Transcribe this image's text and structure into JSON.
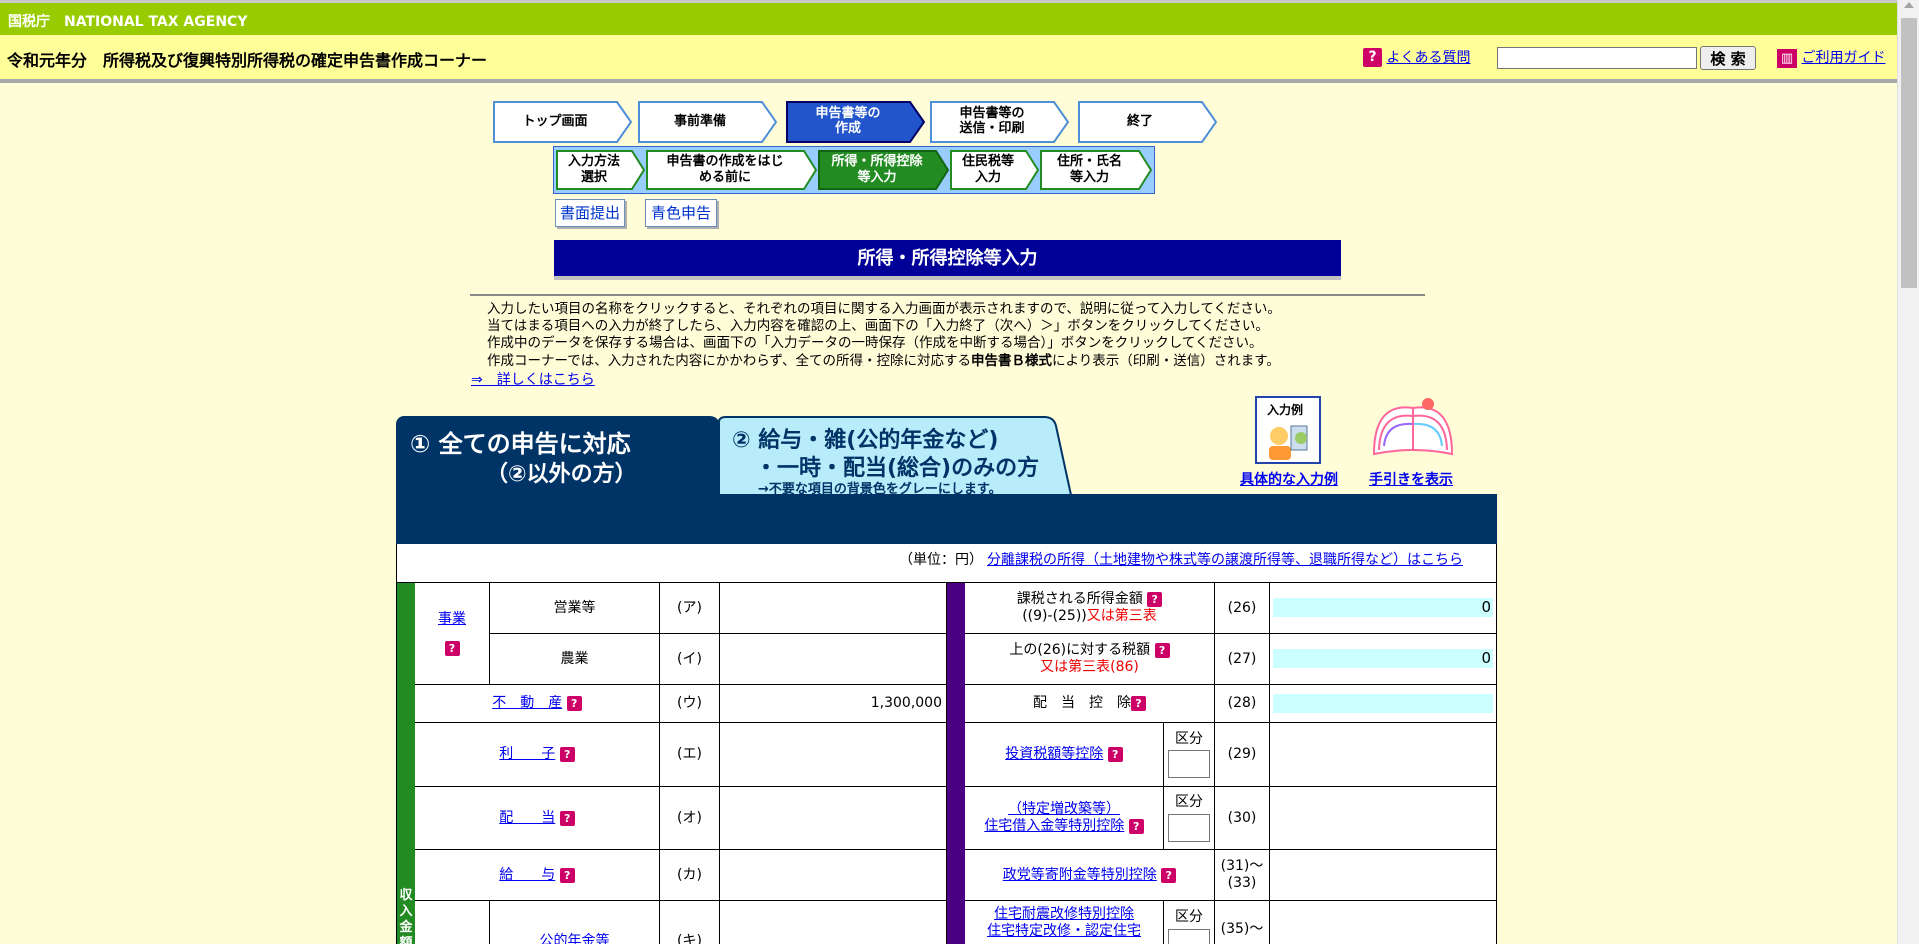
{
  "agency": {
    "name": "国税庁　NATIONAL TAX AGENCY"
  },
  "header": {
    "title": "令和元年分　所得税及び復興特別所得税の確定申告書作成コーナー",
    "faq_label": "よくある質問",
    "search_button": "検 索",
    "search_value": "",
    "guide_label": "ご利用ガイド"
  },
  "steps": [
    {
      "label": "トップ画面",
      "active": false
    },
    {
      "label": "事前準備",
      "active": false
    },
    {
      "label": "申告書等の\n作成",
      "active": true
    },
    {
      "label": "申告書等の\n送信・印刷",
      "active": false
    },
    {
      "label": "終了",
      "active": false
    }
  ],
  "substeps": [
    {
      "label": "入力方法\n選択",
      "active": false
    },
    {
      "label": "申告書の作成をはじ\nめる前に",
      "active": false
    },
    {
      "label": "所得・所得控除\n等入力",
      "active": true
    },
    {
      "label": "住民税等\n入力",
      "active": false
    },
    {
      "label": "住所・氏名\n等入力",
      "active": false
    }
  ],
  "modes": {
    "paper": "書面提出",
    "blue": "青色申告"
  },
  "section_title": "所得・所得控除等入力",
  "instructions": {
    "line1": "入力したい項目の名称をクリックすると、それぞれの項目に関する入力画面が表示されますので、説明に従って入力してください。",
    "line2": "当てはまる項目への入力が終了したら、入力内容を確認の上、画面下の「入力終了（次へ）＞」ボタンをクリックしてください。",
    "line3": "作成中のデータを保存する場合は、画面下の「入力データの一時保存（作成を中断する場合）」ボタンをクリックしてください。",
    "line4_pre": "作成コーナーでは、入力された内容にかかわらず、全ての所得・控除に対応する",
    "line4_bold": "申告書Ｂ様式",
    "line4_post": "により表示（印刷・送信）されます。",
    "detail_link": "⇒　詳しくはこちら"
  },
  "tabs": {
    "tab1_line1": "① 全ての申告に対応",
    "tab1_line2": "（②以外の方）",
    "tab2_line1": "② 給与・雑(公的年金など)",
    "tab2_line2": "・一時・配当(総合)のみの方",
    "tab2_line3": "→不要な項目の背景色をグレーにします。"
  },
  "aids": {
    "example_icon_text": "入力例",
    "example_link": "具体的な入力例",
    "guide_link": "手引きを表示"
  },
  "table": {
    "unit": "（単位：円）",
    "separate_link": "分離課税の所得（土地建物や株式等の譲渡所得等、退職所得など）はこちら",
    "income_vertical": "収入金額等",
    "business": "事業",
    "left_rows": [
      {
        "label": "営業等",
        "code": "(ア)",
        "value": ""
      },
      {
        "label": "農業",
        "code": "(イ)",
        "value": ""
      },
      {
        "label": "不　動　産",
        "code": "(ウ)",
        "value": "1,300,000"
      },
      {
        "label": "利　　子",
        "code": "(エ)",
        "value": ""
      },
      {
        "label": "配　　当",
        "code": "(オ)",
        "value": ""
      },
      {
        "label": "給　　与",
        "code": "(カ)",
        "value": ""
      },
      {
        "label": "公的年金等",
        "code": "(キ)",
        "value": ""
      }
    ],
    "right_rows": [
      {
        "label": "課税される所得金額",
        "label2": "((9)-(25))",
        "red": "又は第三表",
        "code": "(26)",
        "value": "0"
      },
      {
        "label": "上の(26)に対する税額",
        "label2": "",
        "red": "又は第三表(86)",
        "code": "(27)",
        "value": "0"
      },
      {
        "label": "配　当　控　除",
        "code": "(28)",
        "value": ""
      },
      {
        "label": "投資税額等控除",
        "code": "(29)",
        "kubun": "区分"
      },
      {
        "label": "（特定増改築等）",
        "label2": "住宅借入金等特別控除",
        "code": "(30)",
        "kubun": "区分"
      },
      {
        "label": "政党等寄附金等特別控除",
        "code": "(31)～\n(33)"
      },
      {
        "label": "住宅耐震改修特別控除",
        "label2": "住宅特定改修・認定住宅",
        "code": "(35)～",
        "kubun": "区分"
      }
    ]
  },
  "colors": {
    "agency_bar": "#99cc00",
    "title_bar": "#ffff99",
    "page_bg": "#fffcd8",
    "nav_navy": "#000099",
    "tab_navy": "#003366",
    "income_green": "#228b22",
    "tax_purple": "#4b0082",
    "help_icon": "#cc0066"
  }
}
